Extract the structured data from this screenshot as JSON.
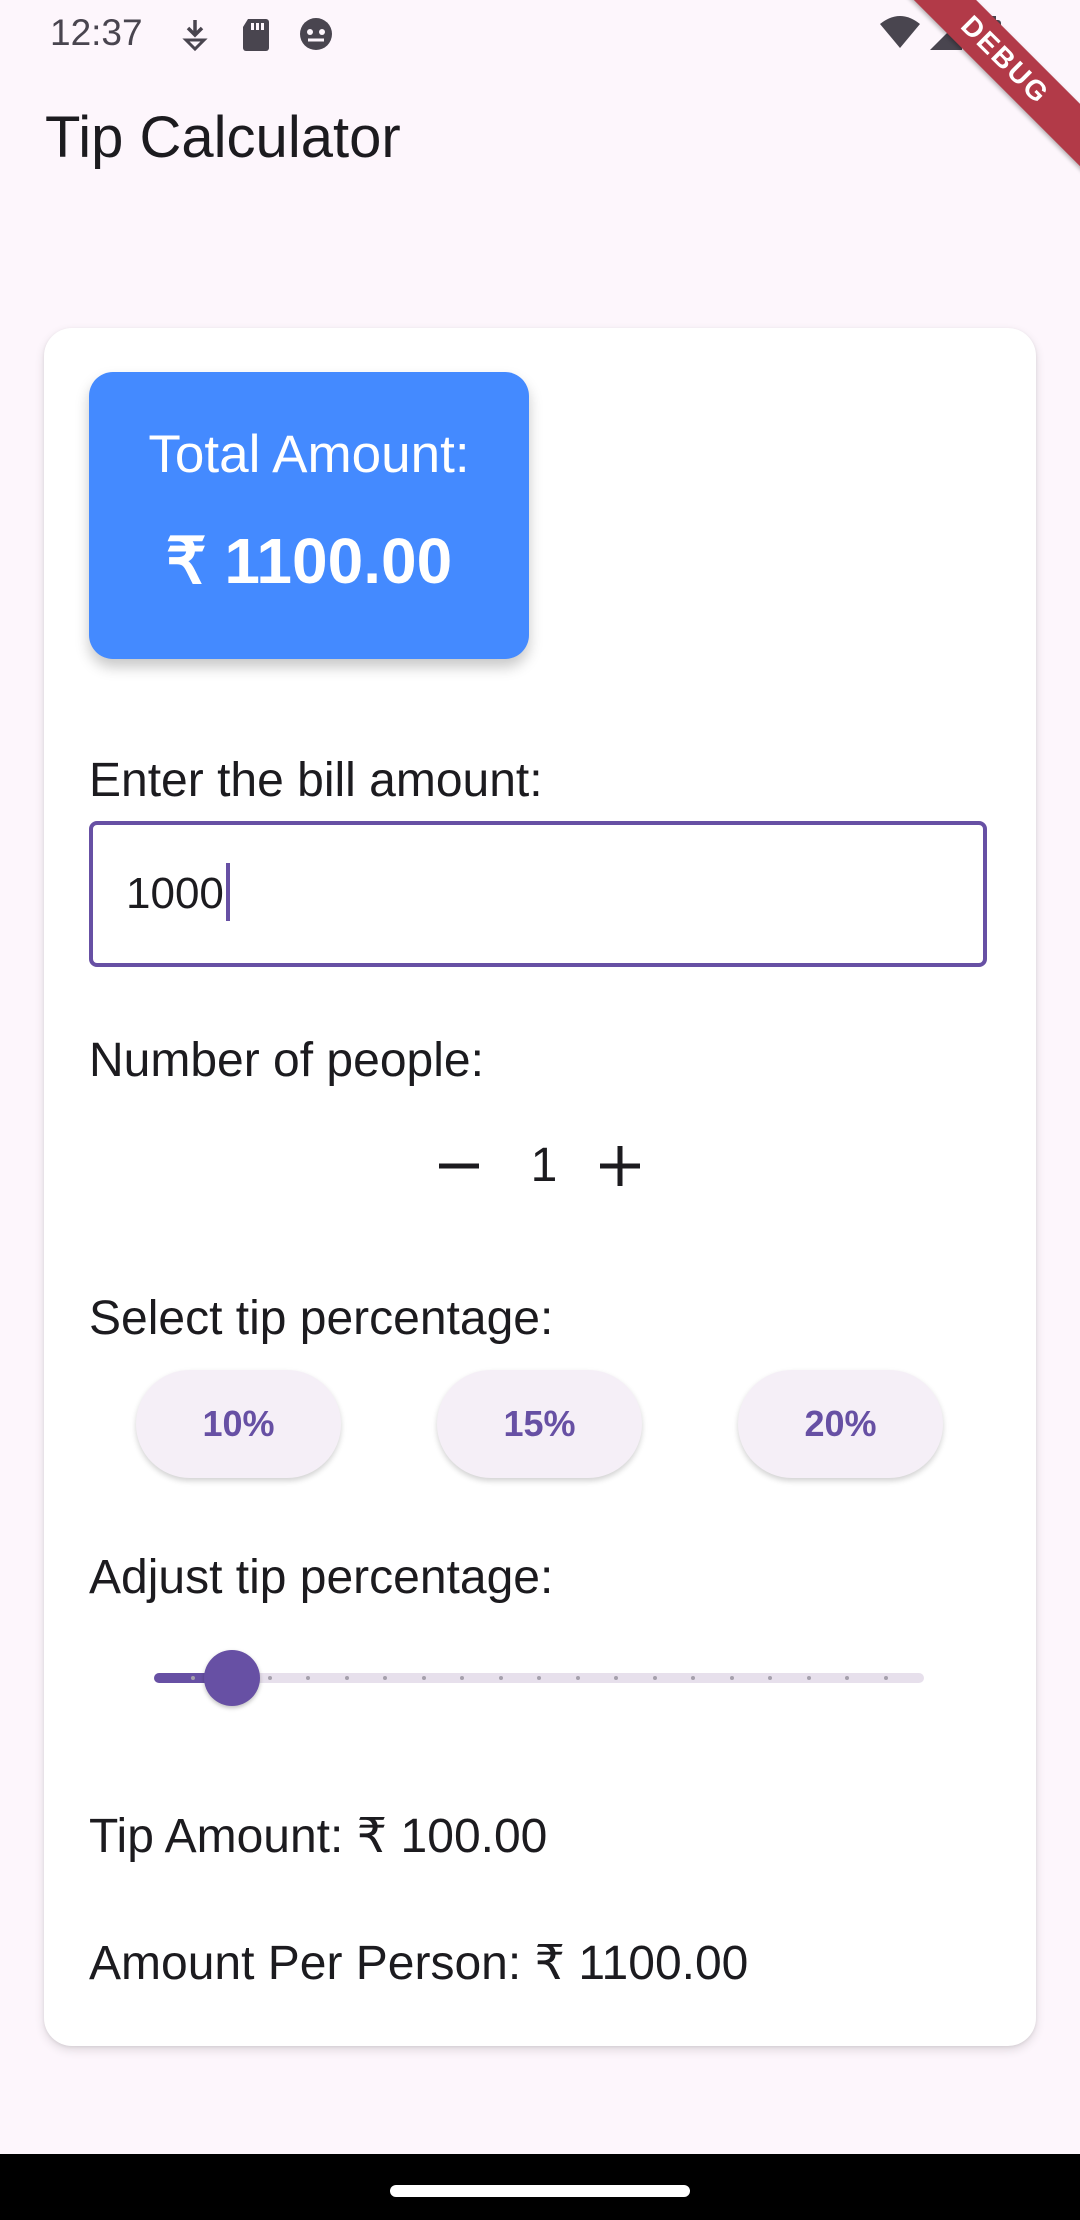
{
  "status_bar": {
    "time": "12:37",
    "icons": [
      "download-icon",
      "sd-card-icon",
      "android-debug-icon",
      "wifi-icon",
      "signal-icon",
      "battery-icon"
    ]
  },
  "debug_banner": "DEBUG",
  "app_bar": {
    "title": "Tip Calculator"
  },
  "total": {
    "label": "Total Amount:",
    "value": "₹ 1100.00"
  },
  "bill": {
    "label": "Enter the bill amount:",
    "value": "1000"
  },
  "people": {
    "label": "Number of people:",
    "count": "1",
    "decrement_icon": "minus-icon",
    "increment_icon": "plus-icon"
  },
  "tip_select": {
    "label": "Select tip percentage:",
    "options": [
      "10%",
      "15%",
      "20%"
    ]
  },
  "tip_adjust": {
    "label": "Adjust tip percentage:",
    "value_percent": 10
  },
  "results": {
    "tip_amount": "Tip Amount: ₹ 100.00",
    "per_person": "Amount Per Person: ₹ 1100.00"
  },
  "colors": {
    "accent": "#6750a4",
    "total_box": "#448aff",
    "background": "#fdf6fc",
    "debug_ribbon": "#b23a48"
  }
}
